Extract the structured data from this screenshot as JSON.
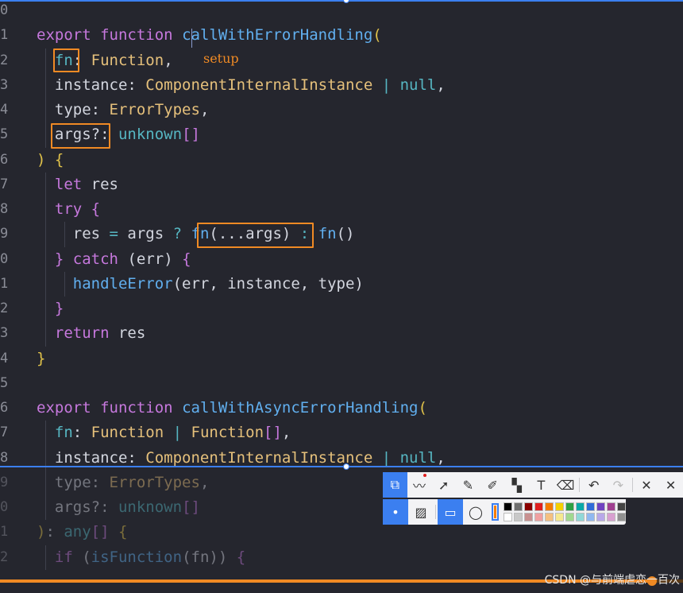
{
  "editor": {
    "line_numbers": [
      "0",
      "1",
      "2",
      "3",
      "4",
      "5",
      "6",
      "7",
      "8",
      "9",
      "0",
      "1",
      "2",
      "3",
      "4",
      "5",
      "6",
      "7",
      "8",
      "9",
      "0",
      "1",
      "2"
    ],
    "lines": [
      [],
      [
        {
          "t": "export",
          "c": "kw"
        },
        {
          "t": " "
        },
        {
          "t": "function",
          "c": "kw"
        },
        {
          "t": " "
        },
        {
          "t": "callWithErrorHandling",
          "c": "fn"
        },
        {
          "t": "(",
          "c": "par"
        }
      ],
      [
        {
          "t": "  "
        },
        {
          "t": "fn",
          "c": "cy"
        },
        {
          "t": ": ",
          "c": "pu"
        },
        {
          "t": "Function",
          "c": "ty"
        },
        {
          "t": ",",
          "c": "pu"
        }
      ],
      [
        {
          "t": "  "
        },
        {
          "t": "instance",
          "c": "id"
        },
        {
          "t": ": ",
          "c": "pu"
        },
        {
          "t": "ComponentInternalInstance",
          "c": "ty"
        },
        {
          "t": " | ",
          "c": "cy"
        },
        {
          "t": "null",
          "c": "cy"
        },
        {
          "t": ",",
          "c": "pu"
        }
      ],
      [
        {
          "t": "  "
        },
        {
          "t": "type",
          "c": "id"
        },
        {
          "t": ": ",
          "c": "pu"
        },
        {
          "t": "ErrorTypes",
          "c": "ty"
        },
        {
          "t": ",",
          "c": "pu"
        }
      ],
      [
        {
          "t": "  "
        },
        {
          "t": "args?",
          "c": "id"
        },
        {
          "t": ": ",
          "c": "pu"
        },
        {
          "t": "unknown",
          "c": "cy"
        },
        {
          "t": "[]",
          "c": "brk"
        }
      ],
      [
        {
          "t": ")",
          "c": "par"
        },
        {
          "t": " "
        },
        {
          "t": "{",
          "c": "par"
        }
      ],
      [
        {
          "t": "  "
        },
        {
          "t": "let",
          "c": "kw"
        },
        {
          "t": " res",
          "c": "id"
        }
      ],
      [
        {
          "t": "  "
        },
        {
          "t": "try",
          "c": "kw"
        },
        {
          "t": " "
        },
        {
          "t": "{",
          "c": "brk"
        }
      ],
      [
        {
          "t": "    "
        },
        {
          "t": "res",
          "c": "id"
        },
        {
          "t": " = ",
          "c": "cy"
        },
        {
          "t": "args",
          "c": "id"
        },
        {
          "t": " ? ",
          "c": "cy"
        },
        {
          "t": "fn",
          "c": "fn"
        },
        {
          "t": "(...args)",
          "c": "id"
        },
        {
          "t": " : ",
          "c": "cy"
        },
        {
          "t": "fn",
          "c": "fn"
        },
        {
          "t": "()",
          "c": "id"
        }
      ],
      [
        {
          "t": "  "
        },
        {
          "t": "}",
          "c": "brk"
        },
        {
          "t": " "
        },
        {
          "t": "catch",
          "c": "kw"
        },
        {
          "t": " (err) ",
          "c": "id"
        },
        {
          "t": "{",
          "c": "brk"
        }
      ],
      [
        {
          "t": "    "
        },
        {
          "t": "handleError",
          "c": "fn"
        },
        {
          "t": "(err, instance, type)",
          "c": "id"
        }
      ],
      [
        {
          "t": "  "
        },
        {
          "t": "}",
          "c": "brk"
        }
      ],
      [
        {
          "t": "  "
        },
        {
          "t": "return",
          "c": "kw"
        },
        {
          "t": " res",
          "c": "id"
        }
      ],
      [
        {
          "t": "}",
          "c": "par"
        }
      ],
      [],
      [
        {
          "t": "export",
          "c": "kw"
        },
        {
          "t": " "
        },
        {
          "t": "function",
          "c": "kw"
        },
        {
          "t": " "
        },
        {
          "t": "callWithAsyncErrorHandling",
          "c": "fn"
        },
        {
          "t": "(",
          "c": "par"
        }
      ],
      [
        {
          "t": "  "
        },
        {
          "t": "fn",
          "c": "cy"
        },
        {
          "t": ": ",
          "c": "pu"
        },
        {
          "t": "Function",
          "c": "ty"
        },
        {
          "t": " | ",
          "c": "cy"
        },
        {
          "t": "Function",
          "c": "ty"
        },
        {
          "t": "[]",
          "c": "brk"
        },
        {
          "t": ",",
          "c": "pu"
        }
      ],
      [
        {
          "t": "  "
        },
        {
          "t": "instance",
          "c": "id"
        },
        {
          "t": ": ",
          "c": "pu"
        },
        {
          "t": "ComponentInternalInstance",
          "c": "ty"
        },
        {
          "t": " | ",
          "c": "cy"
        },
        {
          "t": "null",
          "c": "cy"
        },
        {
          "t": ",",
          "c": "pu"
        }
      ],
      [
        {
          "t": "  "
        },
        {
          "t": "type",
          "c": "id"
        },
        {
          "t": ": ",
          "c": "pu"
        },
        {
          "t": "ErrorTypes",
          "c": "ty"
        },
        {
          "t": ",",
          "c": "pu"
        }
      ],
      [
        {
          "t": "  "
        },
        {
          "t": "args?",
          "c": "id"
        },
        {
          "t": ": ",
          "c": "pu"
        },
        {
          "t": "unknown",
          "c": "cy"
        },
        {
          "t": "[]",
          "c": "brk"
        }
      ],
      [
        {
          "t": ")",
          "c": "par"
        },
        {
          "t": ": ",
          "c": "pu"
        },
        {
          "t": "any",
          "c": "cy"
        },
        {
          "t": "[]",
          "c": "brk"
        },
        {
          "t": " "
        },
        {
          "t": "{",
          "c": "par"
        }
      ],
      [
        {
          "t": "  "
        },
        {
          "t": "if",
          "c": "kw"
        },
        {
          "t": " ("
        },
        {
          "t": "isFunction",
          "c": "fn"
        },
        {
          "t": "(fn)) ",
          "c": "id"
        },
        {
          "t": "{",
          "c": "brk"
        }
      ]
    ],
    "dimmed_from_line": 19
  },
  "annotation": {
    "label": "setup",
    "color": "#f08a24"
  },
  "toolbar": {
    "row1_tools": [
      {
        "name": "select-tool",
        "icon": "select-icon",
        "glyph": "⧉",
        "active": true
      },
      {
        "name": "polyline-tool",
        "icon": "polyline-icon",
        "glyph": "〰",
        "dot": true
      },
      {
        "name": "arrow-tool",
        "icon": "arrow-icon",
        "glyph": "➚"
      },
      {
        "name": "pen-tool",
        "icon": "pen-icon",
        "glyph": "✎"
      },
      {
        "name": "highlighter-tool",
        "icon": "highlighter-icon",
        "glyph": "✐"
      },
      {
        "name": "mosaic-tool",
        "icon": "mosaic-icon",
        "glyph": "▚"
      },
      {
        "name": "text-tool",
        "icon": "text-icon",
        "glyph": "T"
      },
      {
        "name": "eraser-tool",
        "icon": "eraser-icon",
        "glyph": "⌫"
      },
      {
        "sep": true
      },
      {
        "name": "undo-button",
        "icon": "undo-icon",
        "glyph": "↶"
      },
      {
        "name": "redo-button",
        "icon": "redo-icon",
        "glyph": "↷",
        "off": true
      },
      {
        "sep": true
      },
      {
        "name": "close-button",
        "icon": "close-icon",
        "glyph": "✕"
      },
      {
        "name": "confirm-button",
        "icon": "check-icon",
        "glyph": "✕"
      }
    ],
    "row2_tools": [
      {
        "name": "stroke-thin-tool",
        "icon": "dot-icon",
        "glyph": "•",
        "active": true
      },
      {
        "name": "fill-hatch-tool",
        "icon": "hatch-icon",
        "glyph": "▨"
      },
      {
        "sep": true
      },
      {
        "name": "rectangle-tool",
        "icon": "rectangle-icon",
        "glyph": "▭",
        "active": true
      },
      {
        "name": "ellipse-tool",
        "icon": "ellipse-icon",
        "glyph": "◯"
      }
    ],
    "current_color": "#f57c00",
    "palette": [
      "#000000",
      "#6e6e6e",
      "#8b0000",
      "#e02020",
      "#f57c00",
      "#f5d000",
      "#2ea043",
      "#0aa8a8",
      "#2f6bd8",
      "#6f42c1",
      "#a04090",
      "#444444",
      "#ffffff",
      "#c8c8c8",
      "#c89090",
      "#f0a0a0",
      "#f5c080",
      "#f5e890",
      "#a0d890",
      "#90d8d8",
      "#90b8f0",
      "#b8a8e8",
      "#d8a0d0",
      "#909090"
    ]
  },
  "player": {
    "progress": 0.955
  },
  "watermark": {
    "text": "CSDN @与前端虐恋一百次"
  }
}
